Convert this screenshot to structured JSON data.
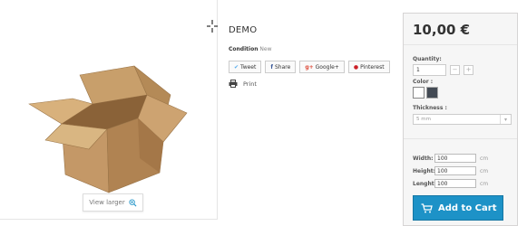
{
  "product": {
    "title": "DEMO",
    "condition_label": "Condition",
    "condition_value": "New",
    "view_larger": "View larger"
  },
  "social": [
    {
      "icon": "twitter-icon",
      "glyph": "✔",
      "label": "Tweet",
      "color": "#55acee"
    },
    {
      "icon": "facebook-icon",
      "glyph": "f",
      "label": "Share",
      "color": "#3b5998"
    },
    {
      "icon": "googleplus-icon",
      "glyph": "g+",
      "label": "Google+",
      "color": "#dd4b39"
    },
    {
      "icon": "pinterest-icon",
      "glyph": "●",
      "label": "Pinterest",
      "color": "#cb2027"
    }
  ],
  "print_label": "Print",
  "panel": {
    "price": "10,00 €",
    "quantity_label": "Quantity:",
    "quantity_value": "1",
    "minus": "−",
    "plus": "+",
    "color_label": "Color :",
    "colors": [
      "#ffffff",
      "#434a54"
    ],
    "thickness_label": "Thickness :",
    "thickness_value": "5 mm",
    "dims": [
      {
        "label": "Width:",
        "value": "100",
        "unit": "cm"
      },
      {
        "label": "Height:",
        "value": "100",
        "unit": "cm"
      },
      {
        "label": "Lenght:",
        "value": "100",
        "unit": "cm"
      }
    ],
    "add_to_cart": "Add to Cart"
  },
  "colors": {
    "accent": "#1d92c7",
    "panel_bg": "#f6f6f6"
  }
}
